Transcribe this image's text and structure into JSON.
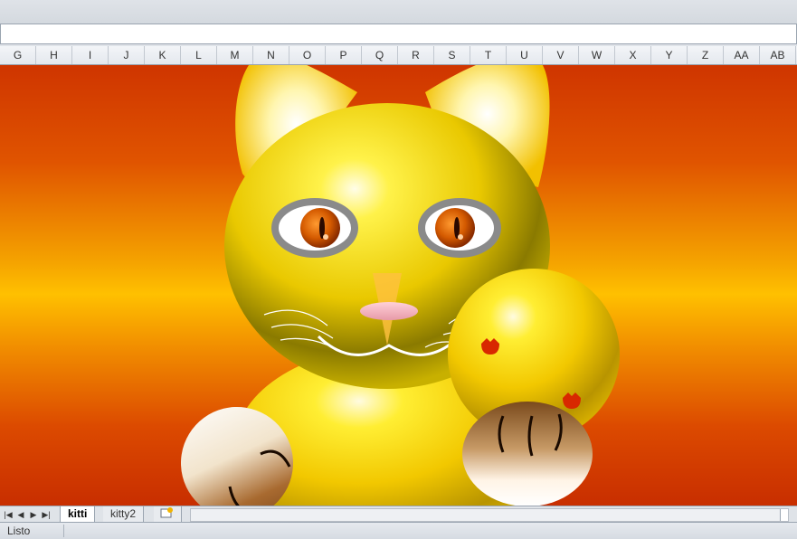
{
  "columns": [
    "G",
    "H",
    "I",
    "J",
    "K",
    "L",
    "M",
    "N",
    "O",
    "P",
    "Q",
    "R",
    "S",
    "T",
    "U",
    "V",
    "W",
    "X",
    "Y",
    "Z",
    "AA",
    "AB"
  ],
  "sheet_tabs": [
    "kitti",
    "kitty2"
  ],
  "nav_buttons": [
    "|◀",
    "◀",
    "▶",
    "▶|"
  ],
  "status": "Listo",
  "colors": {
    "sheet_bg_top": "#cf3500",
    "sheet_bg_mid": "#ffc000",
    "cat_gold": "#ffd000",
    "eye_orange": "#e06000"
  },
  "icons": [
    "new-sheet-icon"
  ]
}
